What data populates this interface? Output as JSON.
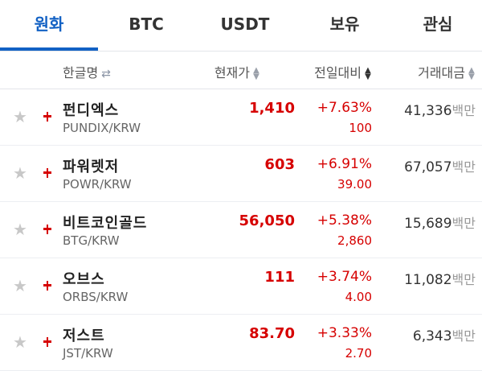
{
  "tabs": [
    {
      "label": "원화"
    },
    {
      "label": "BTC"
    },
    {
      "label": "USDT"
    },
    {
      "label": "보유"
    },
    {
      "label": "관심"
    }
  ],
  "columns": {
    "name": "한글명",
    "price": "현재가",
    "change": "전일대비",
    "volume": "거래대금"
  },
  "colors": {
    "accent": "#1261c4",
    "up": "#d60000"
  },
  "rows": [
    {
      "name": "펀디엑스",
      "ticker": "PUNDIX/KRW",
      "price": "1,410",
      "rate": "+7.63%",
      "diff": "100",
      "volume": "41,336",
      "unit": "백만"
    },
    {
      "name": "파워렛저",
      "ticker": "POWR/KRW",
      "price": "603",
      "rate": "+6.91%",
      "diff": "39.00",
      "volume": "67,057",
      "unit": "백만"
    },
    {
      "name": "비트코인골드",
      "ticker": "BTG/KRW",
      "price": "56,050",
      "rate": "+5.38%",
      "diff": "2,860",
      "volume": "15,689",
      "unit": "백만"
    },
    {
      "name": "오브스",
      "ticker": "ORBS/KRW",
      "price": "111",
      "rate": "+3.74%",
      "diff": "4.00",
      "volume": "11,082",
      "unit": "백만"
    },
    {
      "name": "저스트",
      "ticker": "JST/KRW",
      "price": "83.70",
      "rate": "+3.33%",
      "diff": "2.70",
      "volume": "6,343",
      "unit": "백만"
    }
  ]
}
